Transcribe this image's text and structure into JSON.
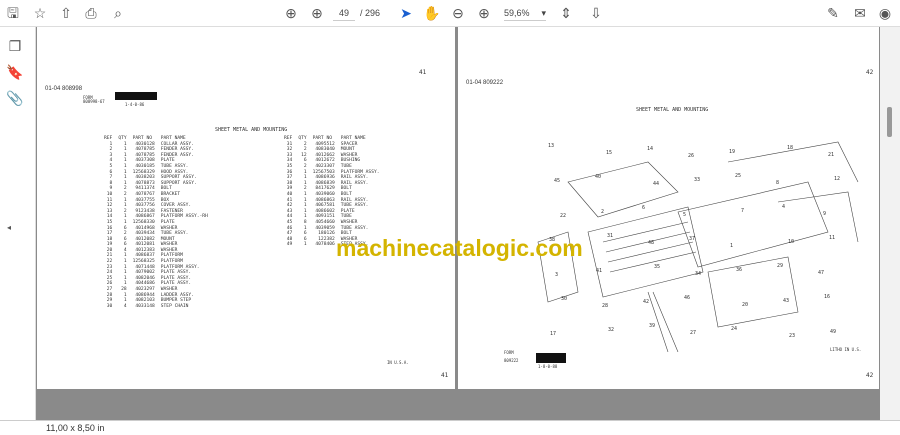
{
  "toolbar": {
    "page_current": "49",
    "page_total": "/ 296",
    "zoom": "59,6%"
  },
  "status": {
    "page_size": "11,00 x 8,50 in"
  },
  "watermark": "machinecatalogic.com",
  "left_page": {
    "header": "01-04  808998",
    "form_label": "FORM",
    "form_code": "808998-67",
    "form_date": "1-4-0-86",
    "title": "SHEET METAL AND MOUNTING",
    "page_no_top": "41",
    "page_no_bottom": "41",
    "footer": "IN U.S.A.",
    "columns": [
      "REF",
      "QTY",
      "PART NO",
      "PART NAME"
    ],
    "rows": [
      [
        "1",
        "1",
        "4030128",
        "COLLAR ASSY."
      ],
      [
        "2",
        "1",
        "4078785",
        "FENDER ASSY."
      ],
      [
        "3",
        "1",
        "4078785",
        "FENDER ASSY."
      ],
      [
        "4",
        "1",
        "4037308",
        "PLATE"
      ],
      [
        "5",
        "1",
        "4030185",
        "TUBE ASSY."
      ],
      [
        "6",
        "1",
        "12568329",
        "HOOD ASSY."
      ],
      [
        "7",
        "1",
        "4038203",
        "SUPPORT ASSY."
      ],
      [
        "8",
        "1",
        "4078873",
        "SUPPORT ASSY."
      ],
      [
        "9",
        "2",
        "9411374",
        "BOLT"
      ],
      [
        "10",
        "2",
        "4078767",
        "BRACKET"
      ],
      [
        "11",
        "1",
        "4037755",
        "BOX"
      ],
      [
        "12",
        "1",
        "4037756",
        "COVER ASSY."
      ],
      [
        "13",
        "2",
        "9123438",
        "FASTENER"
      ],
      [
        "14",
        "1",
        "4086867",
        "PLATFORM ASSY.-RH"
      ],
      [
        "15",
        "1",
        "12568330",
        "PLATE"
      ],
      [
        "16",
        "6",
        "4014968",
        "WASHER"
      ],
      [
        "17",
        "2",
        "4039434",
        "TUBE ASSY."
      ],
      [
        "18",
        "6",
        "4012082",
        "MOUNT"
      ],
      [
        "19",
        "6",
        "4012081",
        "WASHER"
      ],
      [
        "20",
        "4",
        "4012383",
        "WASHER"
      ],
      [
        "21",
        "1",
        "4086837",
        "PLATFORM"
      ],
      [
        "22",
        "1",
        "12568325",
        "PLATFORM"
      ],
      [
        "23",
        "1",
        "4071448",
        "PLATFORM ASSY."
      ],
      [
        "24",
        "1",
        "4079002",
        "PLATE ASSY."
      ],
      [
        "25",
        "1",
        "4082046",
        "PLATE ASSY."
      ],
      [
        "26",
        "1",
        "4044686",
        "PLATE ASSY."
      ],
      [
        "27",
        "28",
        "4023297",
        "WASHER"
      ],
      [
        "28",
        "1",
        "4086944",
        "LADDER ASSY."
      ],
      [
        "29",
        "1",
        "4082103",
        "BUMPER STEP"
      ],
      [
        "30",
        "4",
        "4033148",
        "STEP CHAIN"
      ]
    ],
    "rows2": [
      [
        "31",
        "2",
        "4095512",
        "SPACER"
      ],
      [
        "32",
        "2",
        "4083040",
        "MOUNT"
      ],
      [
        "33",
        "12",
        "4012662",
        "WASHER"
      ],
      [
        "34",
        "6",
        "4012672",
        "BUSHING"
      ],
      [
        "35",
        "2",
        "4023307",
        "TUBE"
      ],
      [
        "36",
        "1",
        "12567503",
        "PLATFORM ASSY."
      ],
      [
        "37",
        "1",
        "4086936",
        "RAIL ASSY."
      ],
      [
        "38",
        "1",
        "4086839",
        "RAIL ASSY."
      ],
      [
        "39",
        "2",
        "8417629",
        "BOLT"
      ],
      [
        "40",
        "1",
        "4039060",
        "BOLT"
      ],
      [
        "41",
        "1",
        "4086863",
        "RAIL ASSY."
      ],
      [
        "42",
        "1",
        "4067581",
        "TUBE ASSY."
      ],
      [
        "43",
        "1",
        "4086602",
        "PLATE"
      ],
      [
        "44",
        "1",
        "4093151",
        "TUBE"
      ],
      [
        "45",
        "8",
        "4054660",
        "WASHER"
      ],
      [
        "46",
        "1",
        "4039059",
        "TUBE ASSY."
      ],
      [
        "47",
        "6",
        "180126",
        "BOLT"
      ],
      [
        "48",
        "6",
        "122382",
        "WASHER"
      ],
      [
        "49",
        "1",
        "4078406",
        "STEP ASSY."
      ]
    ]
  },
  "right_page": {
    "header": "01-04  809222",
    "title": "SHEET METAL AND MOUNTING",
    "page_no_top": "42",
    "page_no_bottom": "42",
    "form_label": "FORM",
    "form_code": "809222",
    "form_date": "1-8-0-88",
    "footer": "LITHO IN U.S.",
    "callouts": [
      "13",
      "15",
      "14",
      "26",
      "19",
      "18",
      "21",
      "45",
      "40",
      "44",
      "33",
      "25",
      "8",
      "12",
      "22",
      "2",
      "6",
      "5",
      "7",
      "4",
      "9",
      "38",
      "31",
      "48",
      "37",
      "1",
      "10",
      "11",
      "3",
      "41",
      "35",
      "34",
      "36",
      "29",
      "47",
      "30",
      "28",
      "42",
      "46",
      "20",
      "43",
      "16",
      "17",
      "32",
      "39",
      "27",
      "24",
      "23",
      "49"
    ]
  }
}
